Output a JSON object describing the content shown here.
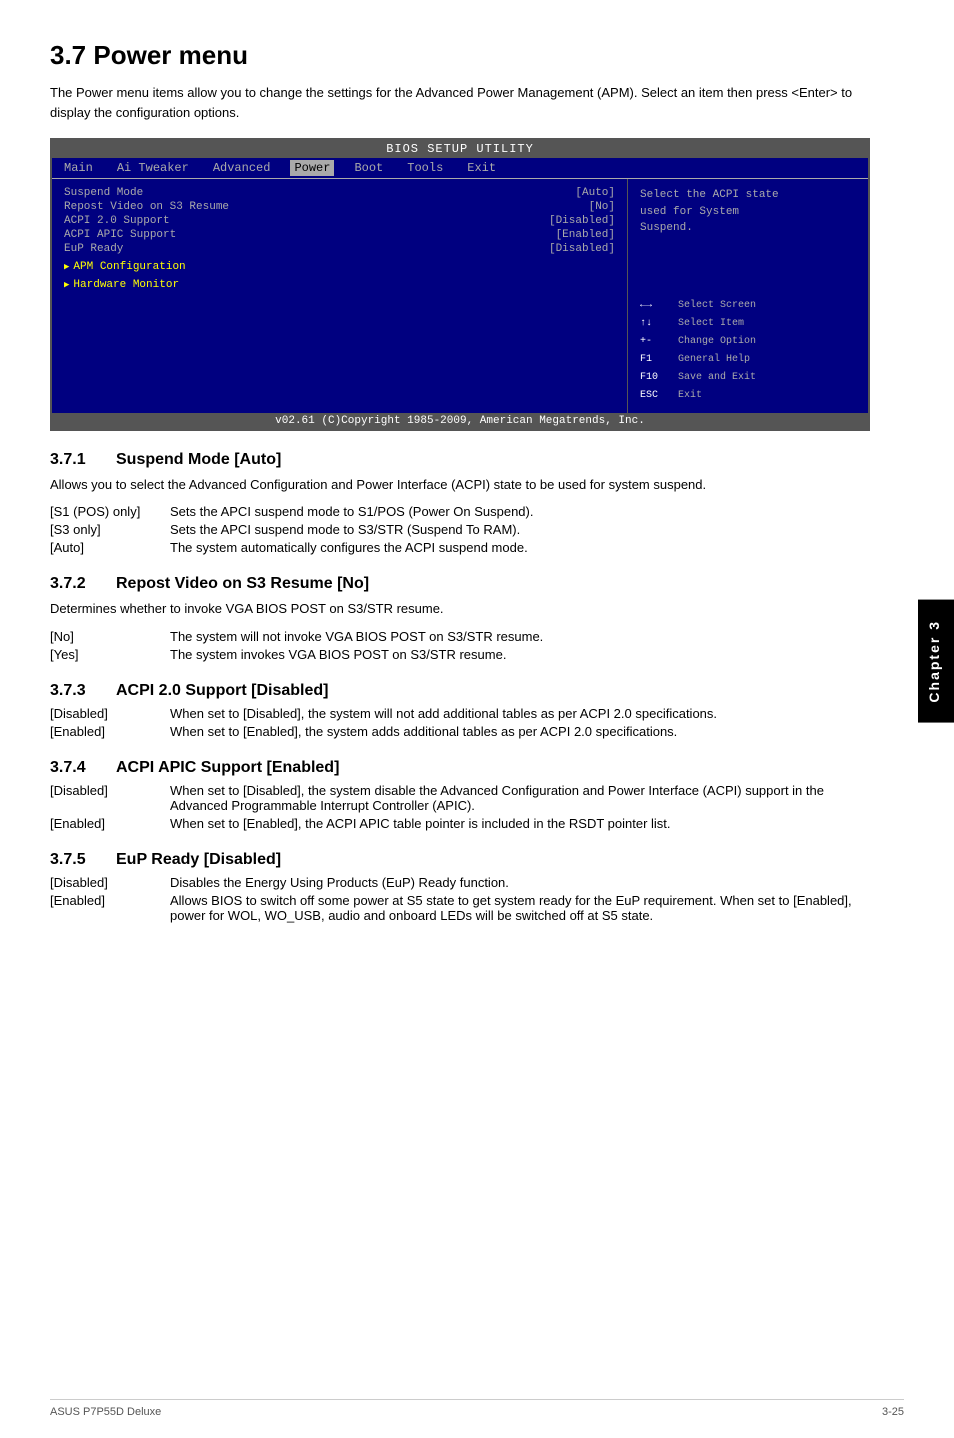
{
  "page": {
    "title": "3.7   Power menu",
    "intro": "The Power menu items allow you to change the settings for the Advanced Power Management (APM). Select an item then press <Enter> to display the configuration options."
  },
  "bios": {
    "title_bar": "BIOS SETUP UTILITY",
    "menu_items": [
      "Main",
      "Ai Tweaker",
      "Advanced",
      "Power",
      "Boot",
      "Tools",
      "Exit"
    ],
    "active_menu": "Power",
    "items": [
      {
        "label": "Suspend Mode",
        "value": "[Auto]"
      },
      {
        "label": "Repost Video on S3 Resume",
        "value": "[No]"
      },
      {
        "label": "ACPI 2.0 Support",
        "value": "[Disabled]"
      },
      {
        "label": "ACPI APIC Support",
        "value": "[Enabled]"
      },
      {
        "label": "EuP Ready",
        "value": "[Disabled]"
      }
    ],
    "submenus": [
      "APM Configuration",
      "Hardware Monitor"
    ],
    "help_text": "Select the ACPI state used for System Suspend.",
    "help_keys": [
      {
        "key": "←→",
        "action": "Select Screen"
      },
      {
        "key": "↑↓",
        "action": "Select Item"
      },
      {
        "key": "+-",
        "action": "Change Option"
      },
      {
        "key": "F1",
        "action": "General Help"
      },
      {
        "key": "F10",
        "action": "Save and Exit"
      },
      {
        "key": "ESC",
        "action": "Exit"
      }
    ],
    "footer": "v02.61  (C)Copyright 1985-2009, American Megatrends, Inc."
  },
  "sections": [
    {
      "id": "3.7.1",
      "title": "Suspend Mode [Auto]",
      "body": "Allows you to select the Advanced Configuration and Power Interface (ACPI) state to be used for system suspend.",
      "options": [
        {
          "key": "[S1 (POS) only]",
          "desc": "Sets the APCI suspend mode to S1/POS (Power On Suspend)."
        },
        {
          "key": "[S3 only]",
          "desc": "Sets the APCI suspend mode to S3/STR (Suspend To RAM)."
        },
        {
          "key": "[Auto]",
          "desc": "The system automatically configures the ACPI suspend mode."
        }
      ]
    },
    {
      "id": "3.7.2",
      "title": "Repost Video on S3 Resume [No]",
      "body": "Determines whether to invoke VGA BIOS POST on S3/STR resume.",
      "options": [
        {
          "key": "[No]",
          "desc": "The system will not invoke VGA BIOS POST on S3/STR resume."
        },
        {
          "key": "[Yes]",
          "desc": "The system invokes VGA BIOS POST on S3/STR resume."
        }
      ]
    },
    {
      "id": "3.7.3",
      "title": "ACPI 2.0 Support [Disabled]",
      "body": "",
      "options": [
        {
          "key": "[Disabled]",
          "desc": "When set to [Disabled], the system will not add additional tables as per ACPI 2.0 specifications."
        },
        {
          "key": "[Enabled]",
          "desc": "When set to [Enabled], the system adds additional tables as per ACPI 2.0 specifications."
        }
      ]
    },
    {
      "id": "3.7.4",
      "title": "ACPI APIC Support [Enabled]",
      "body": "",
      "options": [
        {
          "key": "[Disabled]",
          "desc": "When set to [Disabled], the system disable the Advanced Configuration and Power Interface (ACPI) support in the Advanced Programmable Interrupt Controller (APIC)."
        },
        {
          "key": "[Enabled]",
          "desc": "When set to [Enabled], the ACPI APIC table pointer is included in the RSDT pointer list."
        }
      ]
    },
    {
      "id": "3.7.5",
      "title": "EuP Ready [Disabled]",
      "body": "",
      "options": [
        {
          "key": "[Disabled]",
          "desc": "Disables the Energy Using Products (EuP) Ready function."
        },
        {
          "key": "[Enabled]",
          "desc": "Allows BIOS to switch off some power at S5 state to get system ready for the EuP requirement. When set to [Enabled], power for WOL, WO_USB, audio and onboard LEDs will be switched off at S5 state."
        }
      ]
    }
  ],
  "chapter_tab": "Chapter 3",
  "footer": {
    "left": "ASUS P7P55D Deluxe",
    "right": "3-25"
  }
}
